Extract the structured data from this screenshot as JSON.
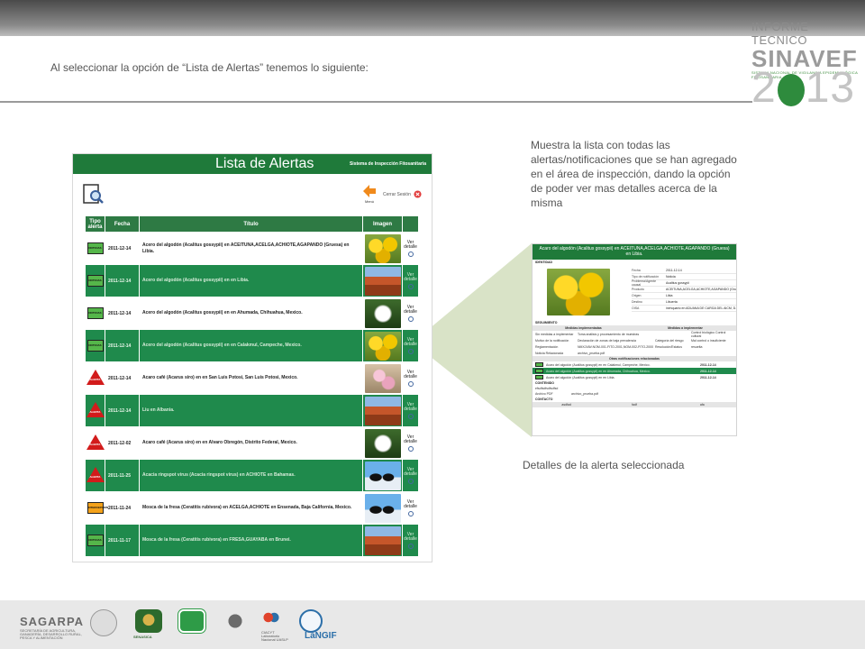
{
  "slide": {
    "intro": "Al seleccionar la opción de “Lista de Alertas” tenemos lo siguiente:",
    "description": "Muestra la lista con todas las alertas/notificaciones que se han agregado en el área de inspección, dando la opción de poder ver mas detalles acerca de la misma",
    "caption": "Detalles de la alerta seleccionada"
  },
  "brand": {
    "top": "INFORME TECNICO",
    "main": "SINAVEF",
    "sub": "SISTEMA NACIONAL DE VIGILANCIA EPIDEMIOLÓGICA FITOSANITARIA",
    "year_a": "2",
    "year_b": "13"
  },
  "alerts_panel": {
    "title": "Lista de Alertas",
    "system": "Sistema de Inspección Fitosanitaria",
    "back_label": "Menú",
    "logout_label": "Cerrar Sesión",
    "columns": [
      "Tipo alerta",
      "Fecha",
      "Título",
      "Imagen"
    ],
    "more_label": "Ver detalle",
    "rows": [
      {
        "badge": "NOTICIAS",
        "date": "2011-12-14",
        "title": "Acero del algodón (Acalitus gossypii) en ACEITUNA,ACELGA,ACHIOTE,AGAPANDO (Gruesa) en Libia."
      },
      {
        "badge": "NOTICIAS",
        "date": "2011-12-14",
        "title": "Acero del algodón (Acalitus gossypii) en en Libia."
      },
      {
        "badge": "NOTICIAS",
        "date": "2011-12-14",
        "title": "Acero del algodón (Acalitus gossypii) en en Ahumada, Chihuahua, Mexico."
      },
      {
        "badge": "NOTICIAS",
        "date": "2011-12-14",
        "title": "Acero del algodón (Acalitus gossypii) en en Calakmul, Campeche, Mexico."
      },
      {
        "badge": "ALERTA",
        "date": "2011-12-14",
        "title": "Acaro café (Acarus siro) en en San Luis Potosi, San Luis Potosi, Mexico."
      },
      {
        "badge": "ALERTA",
        "date": "2011-12-14",
        "title": "Liu en Albania."
      },
      {
        "badge": "ALERTA",
        "date": "2011-12-02",
        "title": "Acaro café (Acarus siro) en en Alvaro Obregón, Distrito Federal, Mexico."
      },
      {
        "badge": "ALERTA",
        "date": "2011-11-25",
        "title": "Acacia ringspot virus (Acacia ringspot virus) en ACHIOTE en Bahamas."
      },
      {
        "badge": "INTERCEPCION",
        "date": "2011-11-24",
        "title": "Mosca de la fresa (Ceratitis rubivora) en ACELGA,ACHIOTE en Ensenada, Baja California, Mexico."
      },
      {
        "badge": "NOTICIAS",
        "date": "2011-11-17",
        "title": "Mosca de la fresa (Ceratitis rubivora) en FRESA,GUAYABA en Brunei."
      }
    ]
  },
  "detail_panel": {
    "header": "Acaro del algodón (Acalitus gossypii) en ACEITUNA,ACELGA,ACHIOTE,AGAPANDO (Gruesa) en Libia.",
    "section_ident": "IDENTIDAD",
    "fields": [
      {
        "k": "Fecha",
        "v": "2011-12-14"
      },
      {
        "k": "Tipo de notificación",
        "v": "Noticia"
      },
      {
        "k": "Problema/Agente causal",
        "v": "Acalitus gossypii"
      },
      {
        "k": "Producto",
        "v": "ACEITUNA,ACELGA,ACHIOTE,AGAPANDO (Gruesa)"
      },
      {
        "k": "Origen",
        "v": "Libia"
      },
      {
        "k": "Destino",
        "v": "Libuerta"
      },
      {
        "k": "OISA",
        "v": "inehquarto en ADUANA DE CARGA DEL AICM, D.F."
      }
    ],
    "section_seg": "SEGUIMIENTO",
    "seg_cols": [
      "Medidas implementadas",
      "Medidas a implementar"
    ],
    "seg_rows": [
      {
        "k": "Sin medidas a implementar",
        "v": "Toma análisis y procesamiento de muestras",
        "k2": "",
        "v2": "Control biológico Control cultural"
      },
      {
        "k": "Motivo de la notificación",
        "v": "Declaración de zonas de baja prevalencia",
        "k2": "Categoría del riesgo",
        "v2": "Mal control o insuficiente"
      },
      {
        "k": "Reglamentación",
        "v": "NMXJVAV.NOM-001-FITO-2001,NOM-002-FITO-2000",
        "k2": "Resolución/Estatus",
        "v2": "resuelta"
      },
      {
        "k": "Noticia Relacionada",
        "v": "archivo_prueba.pdf",
        "k2": "",
        "v2": ""
      }
    ],
    "section_other": "Otras notificaciones relacionadas",
    "other_rows": [
      {
        "t": "Acaro del algodón (Acalitus gossypii) en en Calakmul, Campeche, Mexico.",
        "dt": "2011-12-14",
        "hl": false
      },
      {
        "t": "Acaro del algodón (Acalitus gossypii) en en Ahumada, Chihuahua, Mexico.",
        "dt": "2011-12-14",
        "hl": true
      },
      {
        "t": "Acaro del algodón (Acalitus gossypii) en en Libia.",
        "dt": "2011-12-14",
        "hl": false
      }
    ],
    "section_content": "CONTENIDO",
    "content_text": "efsdfsdfsdfsdfsd",
    "pdf_label": "Archivo PDF",
    "pdf_value": "archivo_prueba.pdf",
    "section_contact": "CONTACTO",
    "contact": [
      "asdfad",
      "fadf",
      "afa"
    ]
  },
  "footer": {
    "sagarpa": "SAGARPA",
    "sagarpa_sub": "SECRETARÍA DE AGRICULTURA, GANADERÍA, DESARROLLO RURAL, PESCA Y ALIMENTACIÓN",
    "senasica": "SENASICA",
    "lab": "CIACYT Laboratorio Nacional UASLP",
    "langif": "LaNGIF"
  },
  "colors": {
    "brand_green": "#1f7a3a",
    "row_green": "#1f8a4c",
    "alert_red": "#d21b1b",
    "notice_green": "#55b64a",
    "interception_orange": "#f4a21a"
  }
}
